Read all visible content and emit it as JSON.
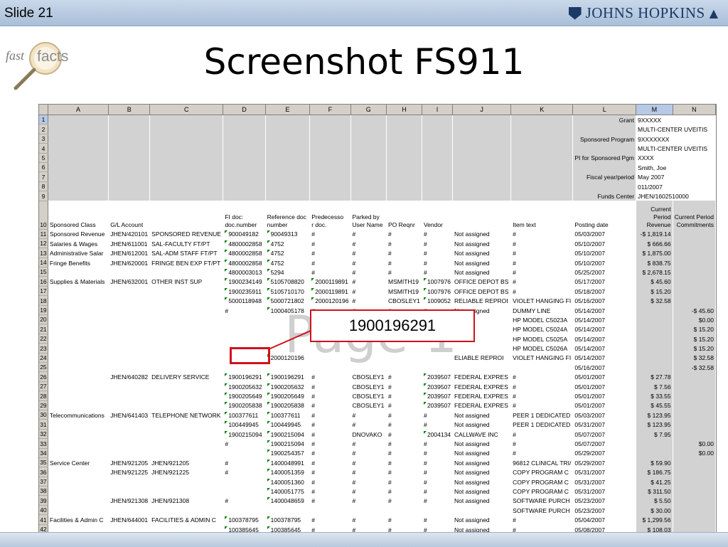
{
  "slide": {
    "label": "Slide 21",
    "title": "Screenshot FS911",
    "brand": "JOHNS HOPKINS"
  },
  "fastfacts": {
    "part1": "fast",
    "part2": "facts"
  },
  "callout": {
    "text": "1900196291"
  },
  "watermark": "Page 1",
  "sheet": {
    "columns": [
      "A",
      "B",
      "C",
      "D",
      "E",
      "F",
      "G",
      "H",
      "I",
      "J",
      "K",
      "L",
      "M",
      "N"
    ],
    "header_info": [
      {
        "row": 1,
        "label": "Grant",
        "value": "9XXXXX"
      },
      {
        "row": 2,
        "label": "",
        "value": "MULTI-CENTER UVEITIS"
      },
      {
        "row": 3,
        "label": "Sponsored Program",
        "value": "9XXXXXXX"
      },
      {
        "row": 4,
        "label": "",
        "value": "MULTI-CENTER UVEITIS"
      },
      {
        "row": 5,
        "label": "PI for Sponsored Pgm",
        "value": "XXXX"
      },
      {
        "row": 6,
        "label": "",
        "value": "Smith, Joe"
      },
      {
        "row": 7,
        "label": "Fiscal year/period",
        "value": "May 2007"
      },
      {
        "row": 8,
        "label": "",
        "value": "011/2007"
      },
      {
        "row": 9,
        "label": "Funds Center",
        "value": "JHEN/1602510000"
      }
    ],
    "col_headers": {
      "A": "Sponsored Class",
      "B": "G/L Account",
      "C": "",
      "D1": "FI doc:",
      "D2": "doc.number",
      "E1": "Reference doc",
      "E2": "number",
      "F1": "Predecesso",
      "F2": "r doc.",
      "G1": "Parked by",
      "G2": "User Name",
      "H": "PO Reqnr",
      "I": "Vendor",
      "J": "",
      "K": "Item text",
      "L": "Posting date",
      "M1": "Current",
      "M2": "Period",
      "M3": "Revenue",
      "N1": "",
      "N2": "Current Period",
      "N3": "Commitments"
    },
    "rows": [
      {
        "n": "11",
        "a": "Sponsored Revenue",
        "b": "JHEN/420101",
        "c": "SPONSORED REVENUE",
        "d": "900049182",
        "e": "90049313",
        "f": "#",
        "g": "#",
        "h": "#",
        "i": "#",
        "j": "Not assigned",
        "k": "#",
        "l": "05/03/2007",
        "m": "-$ 1,819.14",
        "n2": ""
      },
      {
        "n": "12",
        "a": "Salaries & Wages",
        "b": "JHEN/611001",
        "c": "SAL-FACULTY FT/PT",
        "d": "4800002858",
        "e": "4752",
        "f": "#",
        "g": "#",
        "h": "#",
        "i": "#",
        "j": "Not assigned",
        "k": "#",
        "l": "05/10/2007",
        "m": "$ 666.66",
        "n2": ""
      },
      {
        "n": "13",
        "a": "Administrative Salar",
        "b": "JHEN/612001",
        "c": "SAL-ADM STAFF FT/PT",
        "d": "4800002858",
        "e": "4752",
        "f": "#",
        "g": "#",
        "h": "#",
        "i": "#",
        "j": "Not assigned",
        "k": "#",
        "l": "05/10/2007",
        "m": "$ 1,875.00",
        "n2": ""
      },
      {
        "n": "14",
        "a": "Fringe Benefits",
        "b": "JHEN/620001",
        "c": "FRINGE BEN EXP FT/PT",
        "d": "4800002858",
        "e": "4752",
        "f": "#",
        "g": "#",
        "h": "#",
        "i": "#",
        "j": "Not assigned",
        "k": "#",
        "l": "05/10/2007",
        "m": "$ 838.75",
        "n2": ""
      },
      {
        "n": "15",
        "a": "",
        "b": "",
        "c": "",
        "d": "4800003013",
        "e": "5294",
        "f": "#",
        "g": "#",
        "h": "#",
        "i": "#",
        "j": "Not assigned",
        "k": "#",
        "l": "05/25/2007",
        "m": "$ 2,678.15",
        "n2": ""
      },
      {
        "n": "16",
        "a": "Supplies & Materials",
        "b": "JHEN/632001",
        "c": "OTHER INST SUP",
        "d": "1900234149",
        "e": "5105708820",
        "f": "2000119891",
        "g": "#",
        "h": "MSMITH19",
        "i": "1007976",
        "j": "OFFICE DEPOT BS",
        "k": "#",
        "l": "05/17/2007",
        "m": "$ 45.60",
        "n2": ""
      },
      {
        "n": "17",
        "a": "",
        "b": "",
        "c": "",
        "d": "1900235911",
        "e": "5105710170",
        "f": "2000119891",
        "g": "#",
        "h": "MSMITH19",
        "i": "1007976",
        "j": "OFFICE DEPOT BS",
        "k": "#",
        "l": "05/18/2007",
        "m": "$ 15.20",
        "n2": ""
      },
      {
        "n": "18",
        "a": "",
        "b": "",
        "c": "",
        "d": "5000118948",
        "e": "5000721802",
        "f": "2000120196",
        "g": "#",
        "h": "CBOSLEY1",
        "i": "1009052",
        "j": "RELIABLE REPROI",
        "k": "VIOLET HANGING FI",
        "l": "05/16/2007",
        "m": "$ 32.58",
        "n2": ""
      },
      {
        "n": "19",
        "a": "",
        "b": "",
        "c": "",
        "d": "#",
        "e": "1000405178",
        "f": "#",
        "g": "#",
        "h": "#",
        "i": "#",
        "j": "Not assigned",
        "k": "DUMMY LINE",
        "l": "05/14/2007",
        "m": "",
        "n2": "-$ 45.60"
      },
      {
        "n": "20",
        "a": "",
        "b": "",
        "c": "",
        "d": "",
        "e": "",
        "f": "",
        "g": "",
        "h": "",
        "i": "",
        "j": "",
        "k": "HP MODEL C5023A",
        "l": "05/14/2007",
        "m": "",
        "n2": "$0.00"
      },
      {
        "n": "21",
        "a": "",
        "b": "",
        "c": "",
        "d": "",
        "e": "",
        "f": "",
        "g": "",
        "h": "",
        "i": "",
        "j": "",
        "k": "HP MODEL C5024A",
        "l": "05/14/2007",
        "m": "",
        "n2": "$ 15.20"
      },
      {
        "n": "22",
        "a": "",
        "b": "",
        "c": "",
        "d": "",
        "e": "",
        "f": "",
        "g": "",
        "h": "",
        "i": "",
        "j": "",
        "k": "HP MODEL C5025A",
        "l": "05/14/2007",
        "m": "",
        "n2": "$ 15.20"
      },
      {
        "n": "23",
        "a": "",
        "b": "",
        "c": "",
        "d": "",
        "e": "",
        "f": "",
        "g": "",
        "h": "",
        "i": "",
        "j": "",
        "k": "HP MODEL C5026A",
        "l": "05/14/2007",
        "m": "",
        "n2": "$ 15.20"
      },
      {
        "n": "24",
        "a": "",
        "b": "",
        "c": "",
        "d": "",
        "e": "2000120196",
        "f": "",
        "g": "",
        "h": "",
        "i": "",
        "j": "ELIABLE REPROI",
        "k": "VIOLET HANGING FI",
        "l": "05/14/2007",
        "m": "",
        "n2": "$ 32.58"
      },
      {
        "n": "25",
        "a": "",
        "b": "",
        "c": "",
        "d": "",
        "e": "",
        "f": "",
        "g": "",
        "h": "",
        "i": "",
        "j": "",
        "k": "",
        "l": "05/16/2007",
        "m": "",
        "n2": "-$ 32.58"
      },
      {
        "n": "26",
        "a": "",
        "b": "JHEN/640282",
        "c": "DELIVERY SERVICE",
        "d": "1900196291",
        "e": "1900196291",
        "f": "#",
        "g": "CBOSLEY1",
        "h": "#",
        "i": "2039507",
        "j": "FEDERAL EXPRES",
        "k": "#",
        "l": "05/01/2007",
        "m": "$ 27.78",
        "n2": ""
      },
      {
        "n": "27",
        "a": "",
        "b": "",
        "c": "",
        "d": "1900205632",
        "e": "1900205632",
        "f": "#",
        "g": "CBOSLEY1",
        "h": "#",
        "i": "2039507",
        "j": "FEDERAL EXPRES",
        "k": "#",
        "l": "05/01/2007",
        "m": "$ 7.56",
        "n2": ""
      },
      {
        "n": "28",
        "a": "",
        "b": "",
        "c": "",
        "d": "1900205649",
        "e": "1900205649",
        "f": "#",
        "g": "CBOSLEY1",
        "h": "#",
        "i": "2039507",
        "j": "FEDERAL EXPRES",
        "k": "#",
        "l": "05/01/2007",
        "m": "$ 33.55",
        "n2": ""
      },
      {
        "n": "29",
        "a": "",
        "b": "",
        "c": "",
        "d": "1900205838",
        "e": "1900205838",
        "f": "#",
        "g": "CBOSLEY1",
        "h": "#",
        "i": "2039507",
        "j": "FEDERAL EXPRES",
        "k": "#",
        "l": "05/01/2007",
        "m": "$ 45.55",
        "n2": ""
      },
      {
        "n": "30",
        "a": "Telecommunications",
        "b": "JHEN/641403",
        "c": "TELEPHONE NETWORK",
        "d": "100377611",
        "e": "100377611",
        "f": "#",
        "g": "#",
        "h": "#",
        "i": "#",
        "j": "Not assigned",
        "k": "PEER 1 DEDICATED",
        "l": "05/03/2007",
        "m": "$ 123.95",
        "n2": ""
      },
      {
        "n": "31",
        "a": "",
        "b": "",
        "c": "",
        "d": "100449945",
        "e": "100449945",
        "f": "#",
        "g": "#",
        "h": "#",
        "i": "#",
        "j": "Not assigned",
        "k": "PEER 1 DEDICATED",
        "l": "05/31/2007",
        "m": "$ 123.95",
        "n2": ""
      },
      {
        "n": "32",
        "a": "",
        "b": "",
        "c": "",
        "d": "1900215094",
        "e": "1900215094",
        "f": "#",
        "g": "DNOVAKO",
        "h": "#",
        "i": "2004134",
        "j": "CALLWAVE INC",
        "k": "#",
        "l": "05/07/2007",
        "m": "$ 7.95",
        "n2": ""
      },
      {
        "n": "33",
        "a": "",
        "b": "",
        "c": "",
        "d": "#",
        "e": "1900215094",
        "f": "#",
        "g": "#",
        "h": "#",
        "i": "#",
        "j": "Not assigned",
        "k": "#",
        "l": "05/07/2007",
        "m": "",
        "n2": "$0.00"
      },
      {
        "n": "34",
        "a": "",
        "b": "",
        "c": "",
        "d": "",
        "e": "1900254357",
        "f": "#",
        "g": "#",
        "h": "#",
        "i": "#",
        "j": "Not assigned",
        "k": "#",
        "l": "05/29/2007",
        "m": "",
        "n2": "$0.00"
      },
      {
        "n": "35",
        "a": "Service Center",
        "b": "JHEN/921205",
        "c": "JHEN/921205",
        "d": "#",
        "e": "1400048991",
        "f": "#",
        "g": "#",
        "h": "#",
        "i": "#",
        "j": "Not assigned",
        "k": "96812 CLINICAL TRI/",
        "l": "05/29/2007",
        "m": "$ 59.90",
        "n2": ""
      },
      {
        "n": "36",
        "a": "",
        "b": "JHEN/921225",
        "c": "JHEN/921225",
        "d": "#",
        "e": "1400051359",
        "f": "#",
        "g": "#",
        "h": "#",
        "i": "#",
        "j": "Not assigned",
        "k": "COPY PROGRAM C",
        "l": "05/31/2007",
        "m": "$ 186.75",
        "n2": ""
      },
      {
        "n": "37",
        "a": "",
        "b": "",
        "c": "",
        "d": "",
        "e": "1400051360",
        "f": "#",
        "g": "#",
        "h": "#",
        "i": "#",
        "j": "Not assigned",
        "k": "COPY PROGRAM C",
        "l": "05/31/2007",
        "m": "$ 41.25",
        "n2": ""
      },
      {
        "n": "38",
        "a": "",
        "b": "",
        "c": "",
        "d": "",
        "e": "1400051775",
        "f": "#",
        "g": "#",
        "h": "#",
        "i": "#",
        "j": "Not assigned",
        "k": "COPY PROGRAM C",
        "l": "05/31/2007",
        "m": "$ 311.50",
        "n2": ""
      },
      {
        "n": "39",
        "a": "",
        "b": "JHEN/921308",
        "c": "JHEN/921308",
        "d": "#",
        "e": "1400048659",
        "f": "#",
        "g": "#",
        "h": "#",
        "i": "#",
        "j": "Not assigned",
        "k": "SOFTWARE PURCH",
        "l": "05/23/2007",
        "m": "$ 5.50",
        "n2": ""
      },
      {
        "n": "40",
        "a": "",
        "b": "",
        "c": "",
        "d": "",
        "e": "",
        "f": "",
        "g": "",
        "h": "",
        "i": "",
        "j": "",
        "k": "SOFTWARE PURCH",
        "l": "05/23/2007",
        "m": "$ 30.00",
        "n2": ""
      },
      {
        "n": "41",
        "a": "Facilities & Admin C",
        "b": "JHEN/644001",
        "c": "FACILITIES & ADMIN C",
        "d": "100378795",
        "e": "100378795",
        "f": "#",
        "g": "#",
        "h": "#",
        "i": "#",
        "j": "Not assigned",
        "k": "#",
        "l": "05/04/2007",
        "m": "$ 1,299.56",
        "n2": ""
      },
      {
        "n": "42",
        "a": "",
        "b": "",
        "c": "",
        "d": "100385645",
        "e": "100385645",
        "f": "#",
        "g": "#",
        "h": "#",
        "i": "#",
        "j": "Not assigned",
        "k": "#",
        "l": "05/08/2007",
        "m": "$ 108.03",
        "n2": ""
      },
      {
        "n": "43",
        "a": "",
        "b": "",
        "c": "",
        "d": "100388434",
        "e": "100388434",
        "f": "#",
        "g": "#",
        "h": "#",
        "i": "#",
        "j": "Not assigned",
        "k": "#",
        "l": "05/09/2007",
        "m": "$ 2,592.41",
        "n2": ""
      },
      {
        "n": "44",
        "a": "",
        "b": "",
        "c": "",
        "d": "100391269",
        "e": "100391269",
        "f": "#",
        "g": "#",
        "h": "#",
        "i": "#",
        "j": "Not assigned",
        "k": "#",
        "l": "05/10/2007",
        "m": "$ 17.64",
        "n2": ""
      },
      {
        "n": "45",
        "a": "",
        "b": "",
        "c": "",
        "d": "100394919",
        "e": "100394919",
        "f": "#",
        "g": "#",
        "h": "#",
        "i": "#",
        "j": "Not assigned",
        "k": "#",
        "l": "05/11/2007",
        "m": "$ 3,260.70",
        "n2": ""
      }
    ]
  }
}
